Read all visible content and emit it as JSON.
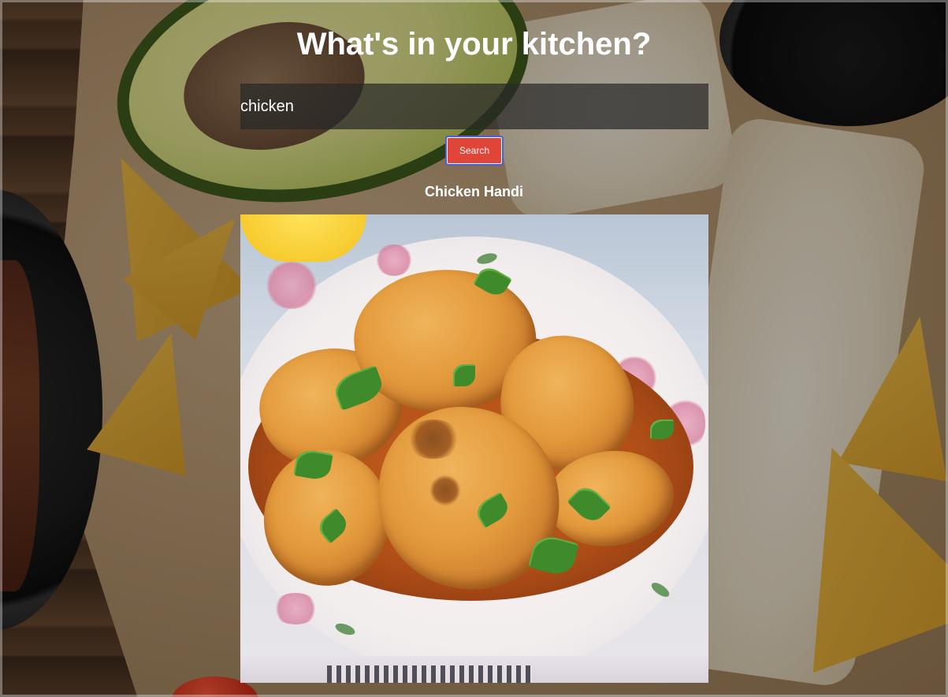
{
  "page": {
    "heading": "What's in your kitchen?"
  },
  "search": {
    "value": "chicken",
    "placeholder": "",
    "button_label": "Search"
  },
  "result": {
    "title": "Chicken Handi",
    "image_alt": "Chicken Handi"
  },
  "colors": {
    "button_background": "#e0453a",
    "button_border": "#4a5fd8",
    "text": "#ffffff",
    "input_background": "#282828"
  }
}
